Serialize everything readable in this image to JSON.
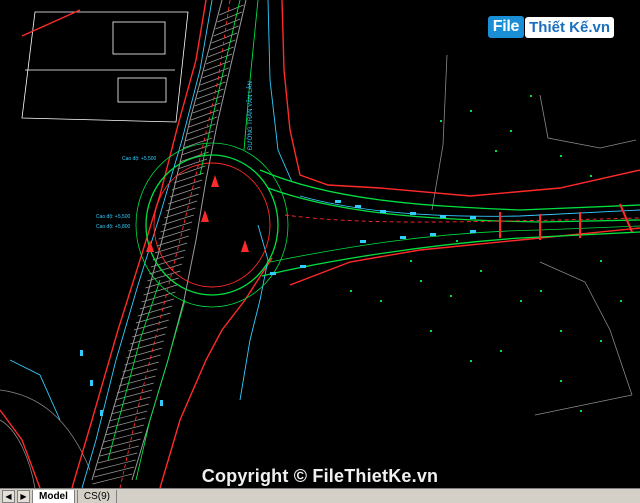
{
  "logo": {
    "part1": "File",
    "part2": "Thiết Kế.vn"
  },
  "watermark": {
    "copyright": "Copyright © FileThietKe.vn"
  },
  "drawing": {
    "road_label": "ĐƯỜNG TRẦN VĂN LÂN",
    "notes": [
      "Cao độ: +5,500",
      "Cao độ: +5,500",
      "Cao độ: +5,800"
    ]
  },
  "tabs": [
    {
      "label": "Model",
      "active": true
    },
    {
      "label": "CS(9)",
      "active": false
    }
  ],
  "nav": {
    "prev_icon": "◀",
    "next_icon": "▶"
  },
  "colors": {
    "red": "#ff2a2a",
    "green": "#00e040",
    "cyan": "#33ccff",
    "white": "#ffffff",
    "grey": "#8a8a8a"
  }
}
